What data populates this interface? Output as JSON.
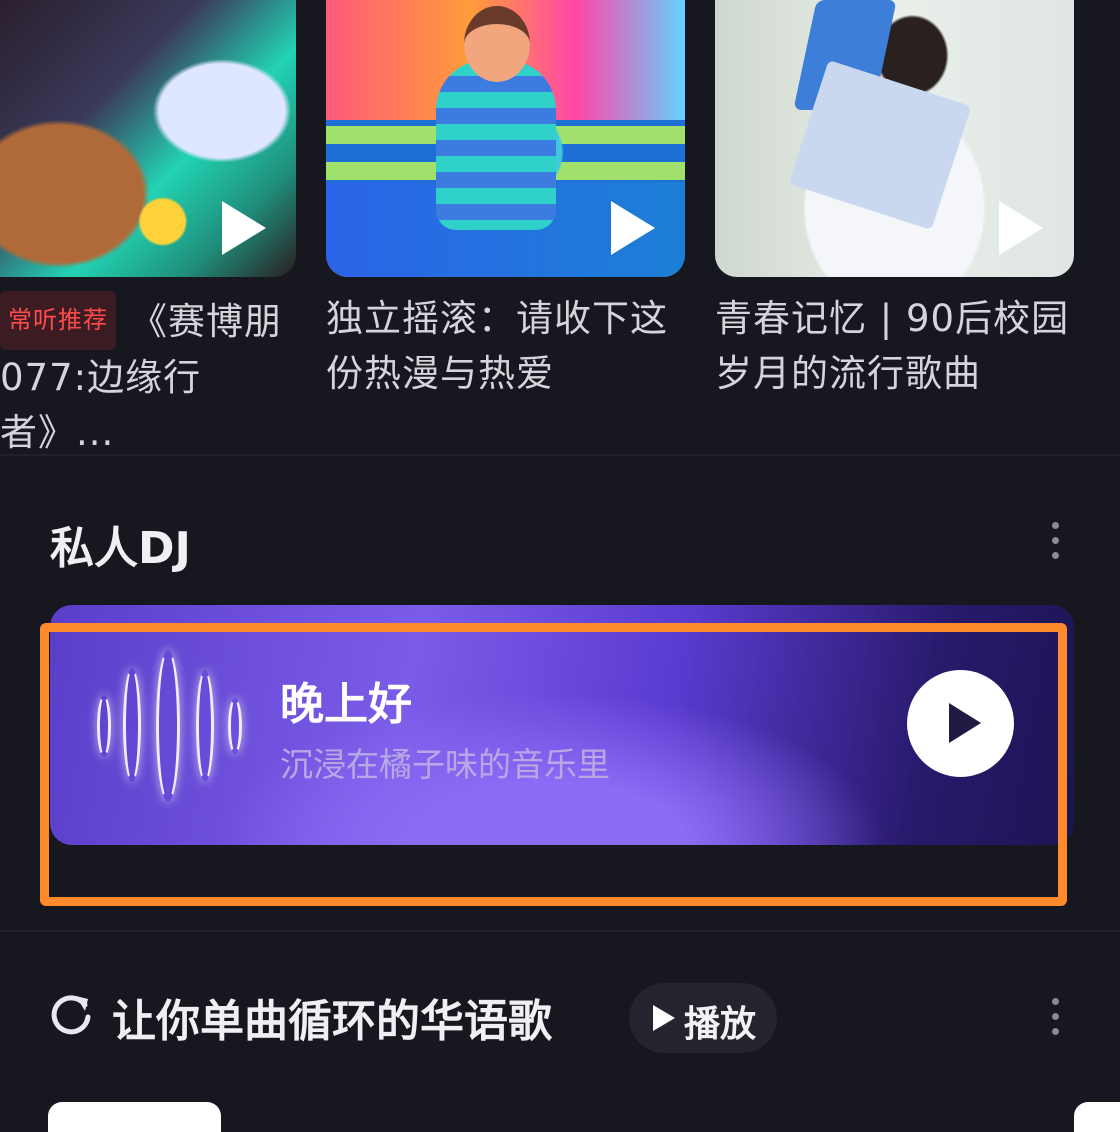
{
  "playlists": [
    {
      "tag": "常听推荐",
      "title_line1": "《赛博朋",
      "title_line2": "077:边缘行者》..."
    },
    {
      "title_line1": "独立摇滚：请收下这",
      "title_line2": "份热漫与热爱"
    },
    {
      "title_line1": "青春记忆 | 90后校园",
      "title_line2": "岁月的流行歌曲"
    }
  ],
  "dj": {
    "section_title": "私人DJ",
    "greeting": "晚上好",
    "subtitle": "沉浸在橘子味的音乐里"
  },
  "next_section": {
    "title": "让你单曲循环的华语歌",
    "play_label": "播放"
  },
  "colors": {
    "background": "#17171f",
    "highlight": "#ff8a2b",
    "tag_text": "#ff4b4b"
  },
  "icons": [
    "play-icon",
    "more-icon",
    "loop-icon",
    "voice-wave-icon"
  ]
}
